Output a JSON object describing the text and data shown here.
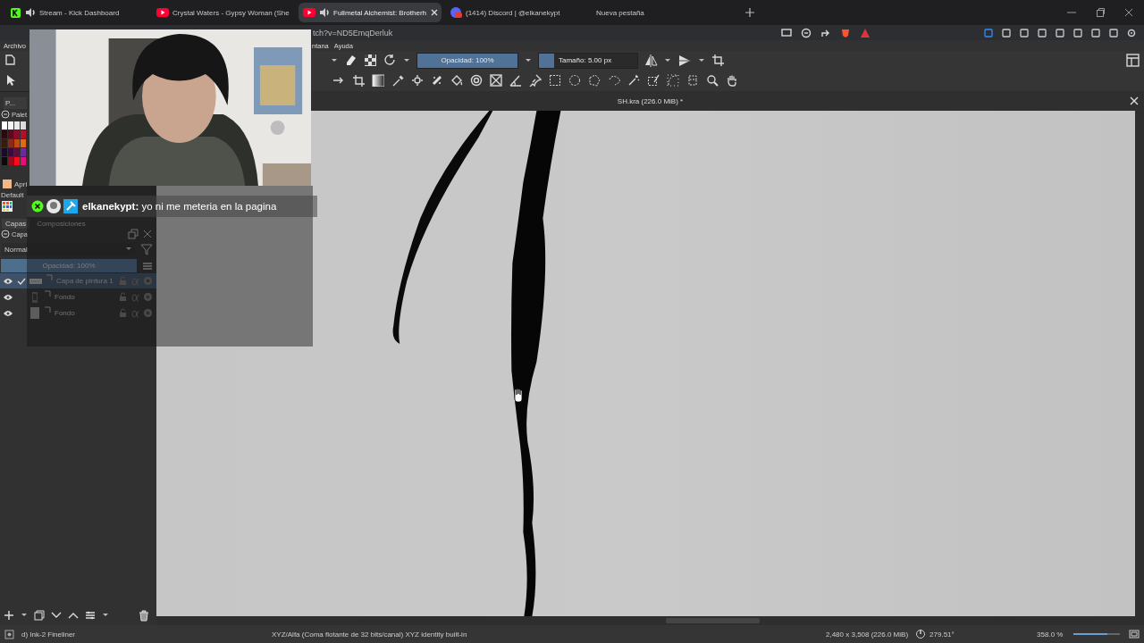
{
  "browser": {
    "tabs": [
      {
        "title": "Stream - Kick Dashboard",
        "muted": true,
        "selected": false
      },
      {
        "title": "Crystal Waters - Gypsy Woman (She",
        "muted": false,
        "selected": false
      },
      {
        "title": "Fullmetal Alchemist: Brotherh",
        "muted": true,
        "selected": true
      },
      {
        "title": "(1414) Discord | @elkanekypt",
        "muted": false,
        "selected": false
      },
      {
        "title": "Nueva pestaña",
        "muted": false,
        "selected": false
      }
    ],
    "address": "tch?v=ND5EmqDerluk"
  },
  "krita": {
    "menu": [
      "Archivo",
      "ntana",
      "Ayuda"
    ],
    "toolbar": {
      "opacity": {
        "label": "Opacidad: 100%",
        "level": 1
      },
      "size": {
        "label": "Tamaño: 5.00 px",
        "level": 0.15
      }
    },
    "document_tab": {
      "title": "SH.kra (226.0 MiB) *"
    },
    "left_docker": {
      "palette_tab": "P...",
      "palette_title": "Palet",
      "swatches": [
        {
          "color": "#ffffff"
        },
        {
          "color": "#f4f4f4"
        },
        {
          "color": "#e8e8e8"
        },
        {
          "color": "#dcdcdc"
        },
        {
          "color": "#2a0a0e"
        },
        {
          "color": "#5a0a1a"
        },
        {
          "color": "#8a0c2a"
        },
        {
          "color": "#b0102a"
        },
        {
          "color": "#3a1a0a"
        },
        {
          "color": "#8a2a1a"
        },
        {
          "color": "#c04a10"
        },
        {
          "color": "#e06a10"
        },
        {
          "color": "#1a0a2a"
        },
        {
          "color": "#3a0a3a"
        },
        {
          "color": "#5a103a"
        },
        {
          "color": "#6a2aa0"
        },
        {
          "color": "#0a0a0a"
        },
        {
          "color": "#a00a1a"
        },
        {
          "color": "#ff0a1a"
        },
        {
          "color": "#e0107a"
        }
      ],
      "preset": {
        "name": "Apri",
        "color": "#f4b888"
      },
      "preset_group": "Default",
      "tabs": [
        {
          "label": "Capas",
          "selected": true
        },
        {
          "label": "Composiciones",
          "selected": false
        }
      ],
      "layers_title": "Capa",
      "blend_mode": "Normal",
      "opacity": {
        "label": "Opacidad:  100%",
        "level": 1
      },
      "layers": [
        {
          "name": "Capa de pintura 1",
          "selected": true,
          "visible": true,
          "kind": "paint"
        },
        {
          "name": "Fondo",
          "selected": false,
          "visible": true,
          "kind": "phone"
        },
        {
          "name": "Fondo",
          "selected": false,
          "visible": true,
          "kind": "page"
        }
      ]
    },
    "status_bar": {
      "brush": "d) Ink-2 Fineliner",
      "color_space": "XYZ/Alfa (Coma flotante de 32 bits/canal)  XYZ identity built-in",
      "image_size": "2,480 x 3,508 (226.0 MiB)",
      "rotation": "279.51°",
      "zoom": "358.0 %",
      "zoom_slider": {
        "level": 0.72
      }
    }
  },
  "overlay": {
    "chat": {
      "username": "elkanekypt:",
      "message": "yo ni me meteria en la pagina"
    }
  }
}
